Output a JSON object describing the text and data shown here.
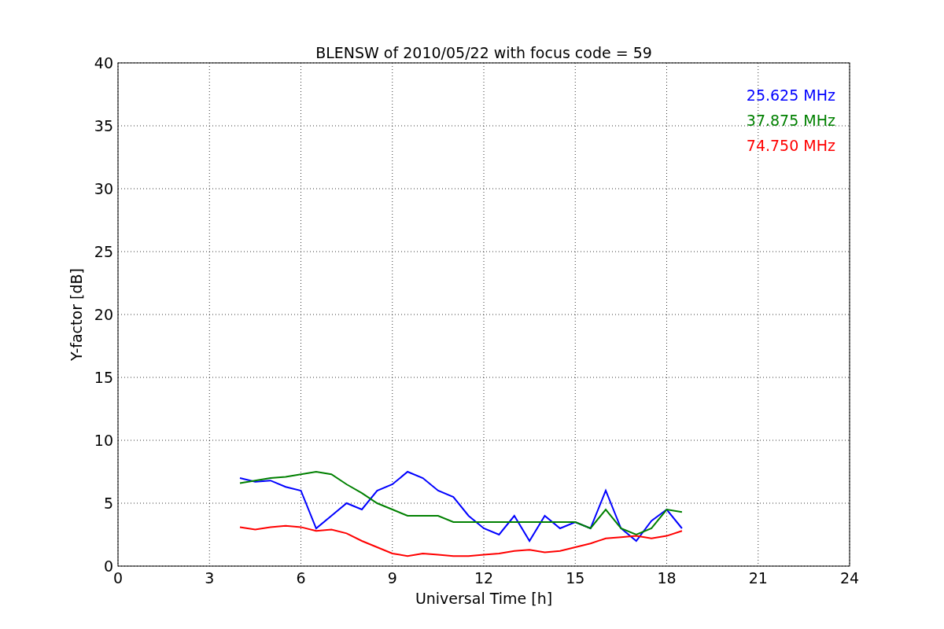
{
  "chart_data": {
    "type": "line",
    "title": "BLENSW of 2010/05/22 with focus code = 59",
    "xlabel": "Universal Time [h]",
    "ylabel": "Y-factor [dB]",
    "x": [
      4,
      4.5,
      5,
      5.5,
      6,
      6.5,
      7,
      7.5,
      8,
      8.5,
      9,
      9.5,
      10,
      10.5,
      11,
      11.5,
      12,
      12.5,
      13,
      13.5,
      14,
      14.5,
      15,
      15.5,
      16,
      16.5,
      17,
      17.5,
      18,
      18.5
    ],
    "series": [
      {
        "name": "25.625 MHz",
        "color": "#0000ff",
        "values": [
          7,
          6.7,
          6.8,
          6.3,
          6,
          3,
          4,
          5,
          4.5,
          6,
          6.5,
          7.5,
          7,
          6,
          5.5,
          4,
          3,
          2.5,
          4,
          2,
          4,
          3,
          3.5,
          3,
          6,
          3,
          2,
          3.6,
          4.5,
          3
        ]
      },
      {
        "name": "37.875 MHz",
        "color": "#008000",
        "values": [
          6.6,
          6.8,
          7,
          7.1,
          7.3,
          7.5,
          7.3,
          6.5,
          5.8,
          5,
          4.5,
          4,
          4,
          4,
          3.5,
          3.5,
          3.5,
          3.5,
          3.5,
          3.5,
          3.5,
          3.5,
          3.5,
          3,
          4.5,
          3,
          2.5,
          3,
          4.5,
          4.3
        ]
      },
      {
        "name": "74.750 MHz",
        "color": "#ff0000",
        "values": [
          3.1,
          2.9,
          3.1,
          3.2,
          3.1,
          2.8,
          2.9,
          2.6,
          2,
          1.5,
          1,
          0.8,
          1,
          0.9,
          0.8,
          0.8,
          0.9,
          1,
          1.2,
          1.3,
          1.1,
          1.2,
          1.5,
          1.8,
          2.2,
          2.3,
          2.4,
          2.2,
          2.4,
          2.8
        ]
      }
    ],
    "xlim": [
      0,
      24
    ],
    "ylim": [
      0,
      40
    ],
    "xticks": [
      0,
      3,
      6,
      9,
      12,
      15,
      18,
      21,
      24
    ],
    "yticks": [
      0,
      5,
      10,
      15,
      20,
      25,
      30,
      35,
      40
    ],
    "grid": true
  }
}
